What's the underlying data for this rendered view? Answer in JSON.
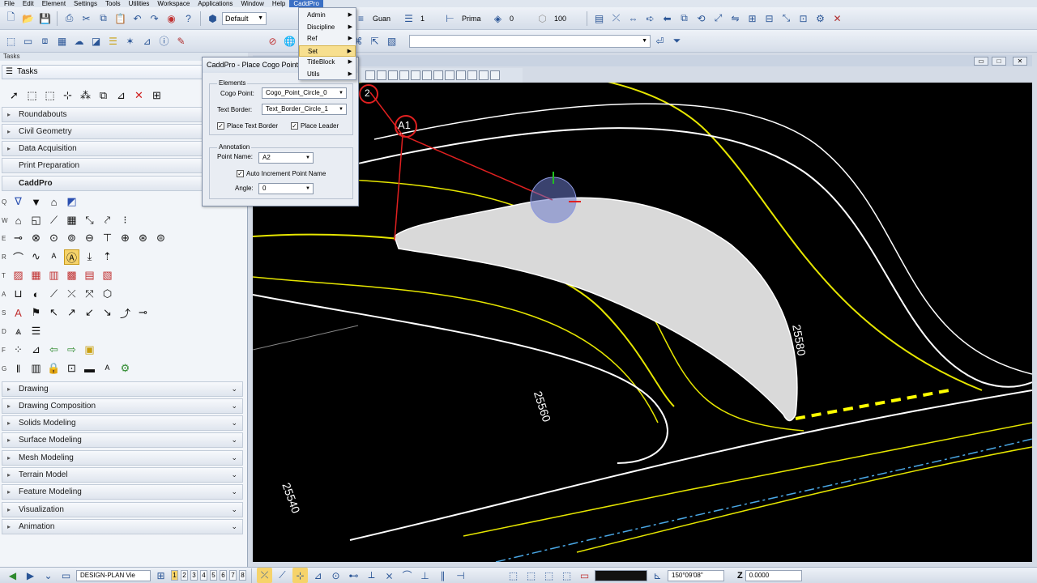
{
  "menubar": [
    "File",
    "Edit",
    "Element",
    "Settings",
    "Tools",
    "Utilities",
    "Workspace",
    "Applications",
    "Window",
    "Help",
    "CaddPro"
  ],
  "toolbar1": {
    "level_combo": "Default",
    "weight_value": "1",
    "style_combo": "Guan",
    "lineweight_value": "1",
    "priority_combo": "Prima",
    "transparency_value": "0",
    "zoom_value": "100"
  },
  "caddpro_menu": {
    "items": [
      {
        "label": "Admin",
        "has_sub": true
      },
      {
        "label": "Discipline",
        "has_sub": true
      },
      {
        "label": "Ref",
        "has_sub": true
      },
      {
        "label": "Set",
        "has_sub": true,
        "highlighted": true
      },
      {
        "label": "TitleBlock",
        "has_sub": true
      },
      {
        "label": "Utils",
        "has_sub": true
      }
    ]
  },
  "left_panel": {
    "tasks_header": "Tasks",
    "tasks_title": "Tasks",
    "categories_top": [
      "Roundabouts",
      "Civil Geometry",
      "Data Acquisition",
      "Print Preparation"
    ],
    "active_category": "CaddPro",
    "row_letters": [
      "Q",
      "W",
      "E",
      "R",
      "T",
      "A",
      "S",
      "D",
      "F",
      "G"
    ],
    "categories_bottom": [
      "Drawing",
      "Drawing Composition",
      "Solids Modeling",
      "Surface Modeling",
      "Mesh Modeling",
      "Terrain Model",
      "Feature Modeling",
      "Visualization",
      "Animation"
    ]
  },
  "dialog": {
    "title": "CaddPro - Place Cogo Point",
    "elements_group": "Elements",
    "cogo_point_label": "Cogo Point:",
    "cogo_point_value": "Cogo_Point_Circle_0",
    "text_border_label": "Text Border:",
    "text_border_value": "Text_Border_Circle_1",
    "place_text_border": "Place Text Border",
    "place_leader": "Place Leader",
    "annotation_group": "Annotation",
    "point_name_label": "Point Name:",
    "point_name_value": "A2",
    "auto_increment": "Auto Increment Point Name",
    "angle_label": "Angle:",
    "angle_value": "0"
  },
  "viewport": {
    "contour_labels": [
      "25580",
      "25560",
      "25540"
    ],
    "point_labels": [
      "A1",
      "2"
    ]
  },
  "statusbar": {
    "model_combo": "DESIGN-PLAN Vie",
    "view_numbers": [
      "1",
      "2",
      "3",
      "4",
      "5",
      "6",
      "7",
      "8"
    ],
    "angle_field": "150°09'08\"",
    "z_label": "Z",
    "z_field": "0.0000"
  },
  "colors": {
    "accent": "#3a6fc4",
    "contour_yellow": "#e6e600",
    "leader_red": "#e02020",
    "highlight": "#f6d36a"
  }
}
